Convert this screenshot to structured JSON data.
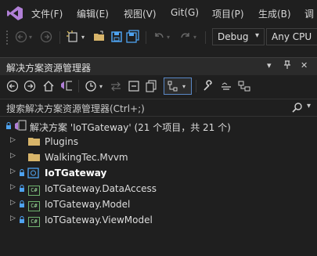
{
  "menu": {
    "items": [
      "文件(F)",
      "编辑(E)",
      "视图(V)",
      "Git(G)",
      "项目(P)",
      "生成(B)",
      "调"
    ]
  },
  "toolbar": {
    "configuration": "Debug",
    "platform": "Any CPU"
  },
  "panel": {
    "title": "解决方案资源管理器",
    "pin_glyph": "▾",
    "close_glyph": "✕",
    "search_placeholder": "搜索解决方案资源管理器(Ctrl+;)"
  },
  "tree": {
    "solution": "解决方案 'IoTGateway' (21 个项目，共 21 个)",
    "items": [
      {
        "label": "Plugins"
      },
      {
        "label": "WalkingTec.Mvvm"
      },
      {
        "label": "IoTGateway"
      },
      {
        "label": "IoTGateway.DataAccess"
      },
      {
        "label": "IoTGateway.Model"
      },
      {
        "label": "IoTGateway.ViewModel"
      }
    ]
  },
  "colors": {
    "background": "#1f1f1f",
    "accent": "#5a88c6",
    "vs_purple": "#b180d7",
    "folder_yellow": "#d8b56a"
  }
}
